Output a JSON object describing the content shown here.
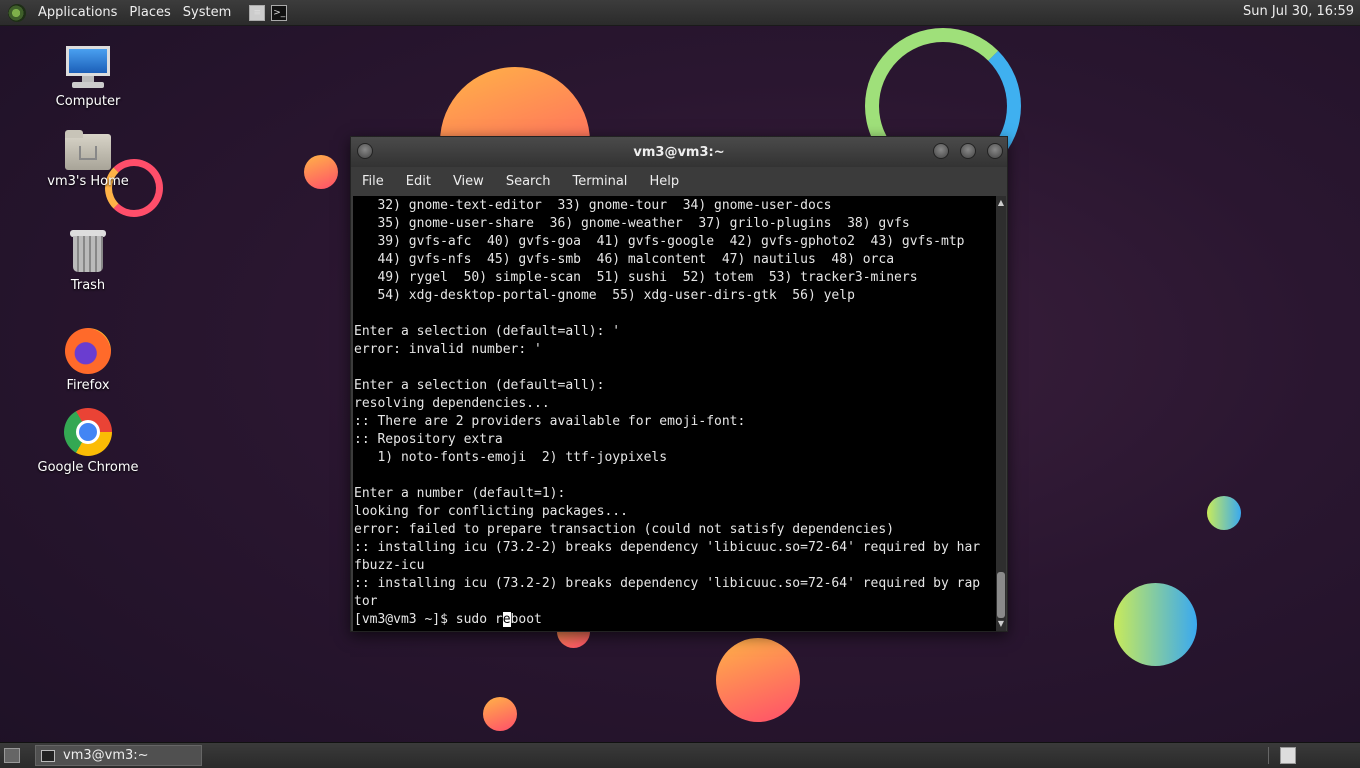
{
  "top_panel": {
    "menus": [
      "Applications",
      "Places",
      "System"
    ],
    "clock": "Sun Jul 30, 16:59"
  },
  "desktop_icons": [
    {
      "label": "Computer",
      "icon": "computer-icon"
    },
    {
      "label": "vm3's Home",
      "icon": "home-folder-icon"
    },
    {
      "label": "Trash",
      "icon": "trash-icon"
    },
    {
      "label": "Firefox",
      "icon": "firefox-icon"
    },
    {
      "label": "Google Chrome",
      "icon": "chrome-icon"
    }
  ],
  "window": {
    "title": "vm3@vm3:~",
    "menu": [
      "File",
      "Edit",
      "View",
      "Search",
      "Terminal",
      "Help"
    ],
    "terminal_lines": [
      "   32) gnome-text-editor  33) gnome-tour  34) gnome-user-docs",
      "   35) gnome-user-share  36) gnome-weather  37) grilo-plugins  38) gvfs",
      "   39) gvfs-afc  40) gvfs-goa  41) gvfs-google  42) gvfs-gphoto2  43) gvfs-mtp",
      "   44) gvfs-nfs  45) gvfs-smb  46) malcontent  47) nautilus  48) orca",
      "   49) rygel  50) simple-scan  51) sushi  52) totem  53) tracker3-miners",
      "   54) xdg-desktop-portal-gnome  55) xdg-user-dirs-gtk  56) yelp",
      "",
      "Enter a selection (default=all): '",
      "error: invalid number: '",
      "",
      "Enter a selection (default=all):",
      "resolving dependencies...",
      ":: There are 2 providers available for emoji-font:",
      ":: Repository extra",
      "   1) noto-fonts-emoji  2) ttf-joypixels",
      "",
      "Enter a number (default=1):",
      "looking for conflicting packages...",
      "error: failed to prepare transaction (could not satisfy dependencies)",
      ":: installing icu (73.2-2) breaks dependency 'libicuuc.so=72-64' required by har",
      "fbuzz-icu",
      ":: installing icu (73.2-2) breaks dependency 'libicuuc.so=72-64' required by rap",
      "tor"
    ],
    "prompt": "[vm3@vm3 ~]$ ",
    "command_before_cursor": "sudo r",
    "cursor_char": "e",
    "command_after_cursor": "boot"
  },
  "taskbar": {
    "task_label": "vm3@vm3:~"
  }
}
